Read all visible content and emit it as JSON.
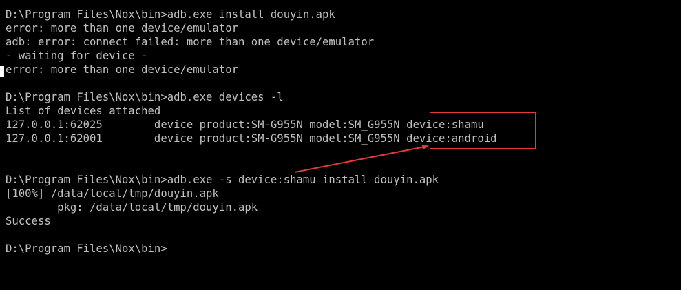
{
  "terminal": {
    "lines": [
      "D:\\Program Files\\Nox\\bin>adb.exe install douyin.apk",
      "error: more than one device/emulator",
      "adb: error: connect failed: more than one device/emulator",
      "- waiting for device -",
      "error: more than one device/emulator",
      "",
      "D:\\Program Files\\Nox\\bin>adb.exe devices -l",
      "List of devices attached",
      "127.0.0.1:62025        device product:SM-G955N model:SM_G955N device:shamu",
      "127.0.0.1:62001        device product:SM-G955N model:SM_G955N device:android",
      "",
      "",
      "D:\\Program Files\\Nox\\bin>adb.exe -s device:shamu install douyin.apk",
      "[100%] /data/local/tmp/douyin.apk",
      "        pkg: /data/local/tmp/douyin.apk",
      "Success",
      "",
      "D:\\Program Files\\Nox\\bin>"
    ]
  },
  "colors": {
    "background": "#000000",
    "text": "#c0c0c0",
    "annotation": "#e23a3a"
  }
}
